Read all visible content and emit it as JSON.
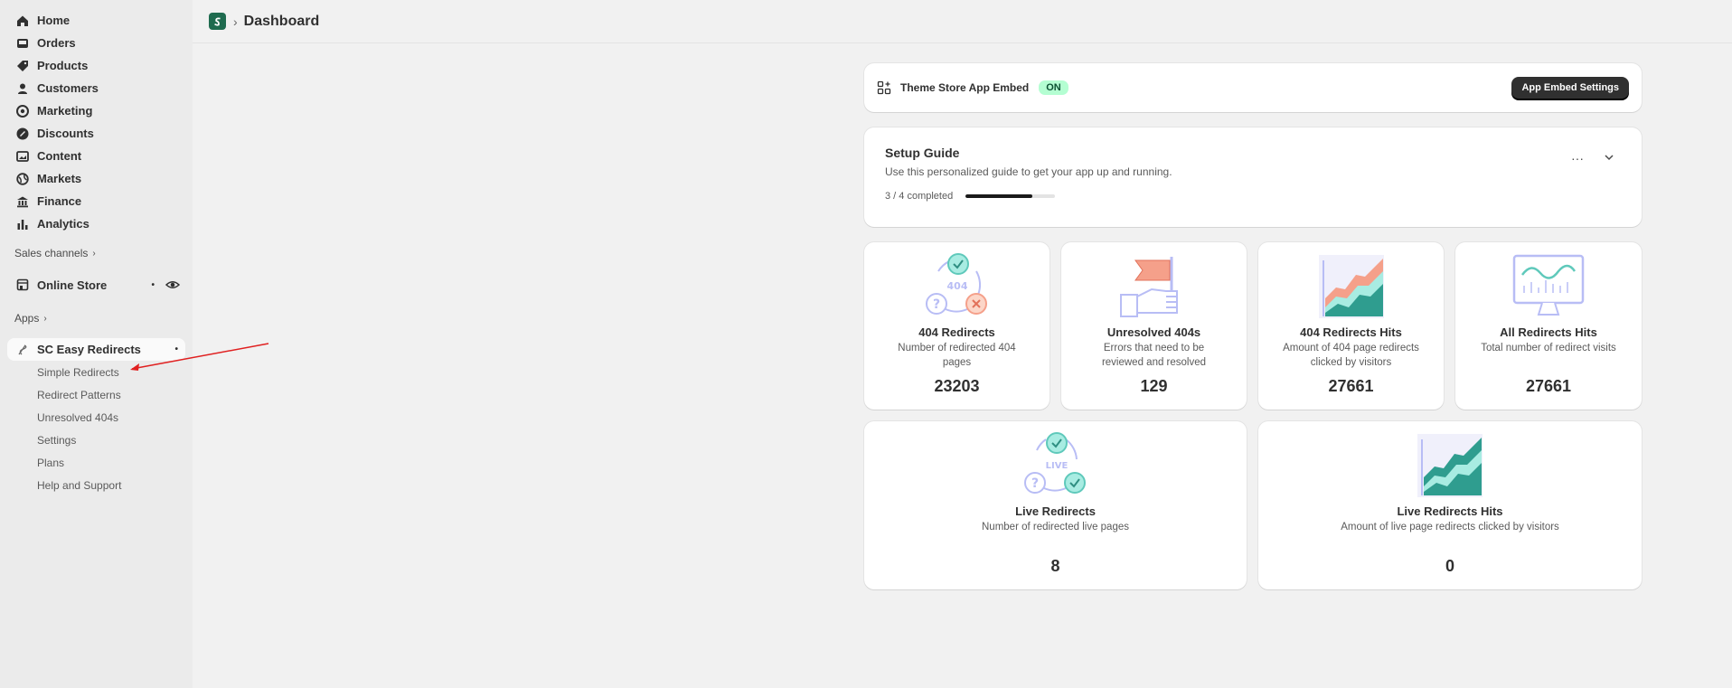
{
  "sidebar": {
    "nav": [
      {
        "label": "Home",
        "icon": "home-icon"
      },
      {
        "label": "Orders",
        "icon": "inbox-icon"
      },
      {
        "label": "Products",
        "icon": "tag-icon"
      },
      {
        "label": "Customers",
        "icon": "person-icon"
      },
      {
        "label": "Marketing",
        "icon": "target-icon"
      },
      {
        "label": "Discounts",
        "icon": "discount-icon"
      },
      {
        "label": "Content",
        "icon": "image-icon"
      },
      {
        "label": "Markets",
        "icon": "globe-icon"
      },
      {
        "label": "Finance",
        "icon": "bank-icon"
      },
      {
        "label": "Analytics",
        "icon": "bar-chart-icon"
      }
    ],
    "sales_channels_label": "Sales channels",
    "online_store_label": "Online Store",
    "apps_label": "Apps",
    "app_name": "SC Easy Redirects",
    "app_subitems": [
      "Simple Redirects",
      "Redirect Patterns",
      "Unresolved 404s",
      "Settings",
      "Plans",
      "Help and Support"
    ]
  },
  "header": {
    "title": "Dashboard"
  },
  "embed": {
    "title": "Theme Store App Embed",
    "status": "ON",
    "button_label": "App Embed Settings"
  },
  "setup": {
    "title": "Setup Guide",
    "subtitle": "Use this personalized guide to get your app up and running.",
    "progress_text": "3 / 4 completed",
    "progress_fraction": 0.75,
    "more_label": "···",
    "collapse_label": "⌄"
  },
  "stats": [
    {
      "title": "404 Redirects",
      "description": "Number of redirected 404 pages",
      "value": "23203"
    },
    {
      "title": "Unresolved 404s",
      "description": "Errors that need to be reviewed and resolved",
      "value": "129"
    },
    {
      "title": "404 Redirects Hits",
      "description": "Amount of 404 page redirects clicked by visitors",
      "value": "27661"
    },
    {
      "title": "All Redirects Hits",
      "description": "Total number of redirect visits",
      "value": "27661"
    },
    {
      "title": "Live Redirects",
      "description": "Number of redirected live pages",
      "value": "8"
    },
    {
      "title": "Live Redirects Hits",
      "description": "Amount of live page redirects clicked by visitors",
      "value": "0"
    }
  ],
  "illustration_text": {
    "code_404": "404",
    "live": "LIVE"
  },
  "colors": {
    "accent_dark": "#303030",
    "on_badge_bg": "#b4fed2",
    "illus_teal": "#5fc9bb",
    "illus_lavender": "#b8bdf5",
    "illus_salmon": "#f5a08a",
    "annotation_red": "#e02020"
  }
}
